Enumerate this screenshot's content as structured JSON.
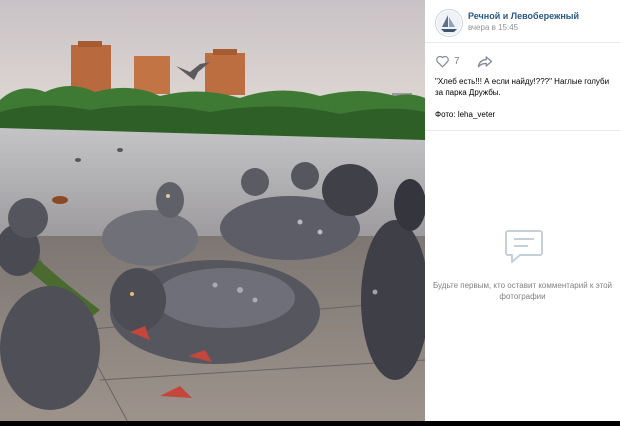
{
  "group": {
    "name": "Речной и Левобережный",
    "time": "вчера в 15:45"
  },
  "likes": {
    "count": "7"
  },
  "post": {
    "caption": "\"Хлеб есть!!! А если найду!???\" Наглые голуби за парка Дружбы.",
    "credit": "Фото: leha_veter"
  },
  "comments": {
    "empty_text": "Будьте первым, кто оставит комментарий к этой фотографии"
  },
  "colors": {
    "link": "#2a5885",
    "muted": "#828282"
  },
  "icons": [
    "heart-icon",
    "share-arrow-icon",
    "comment-bubble-icon",
    "sailboat-logo-icon"
  ]
}
